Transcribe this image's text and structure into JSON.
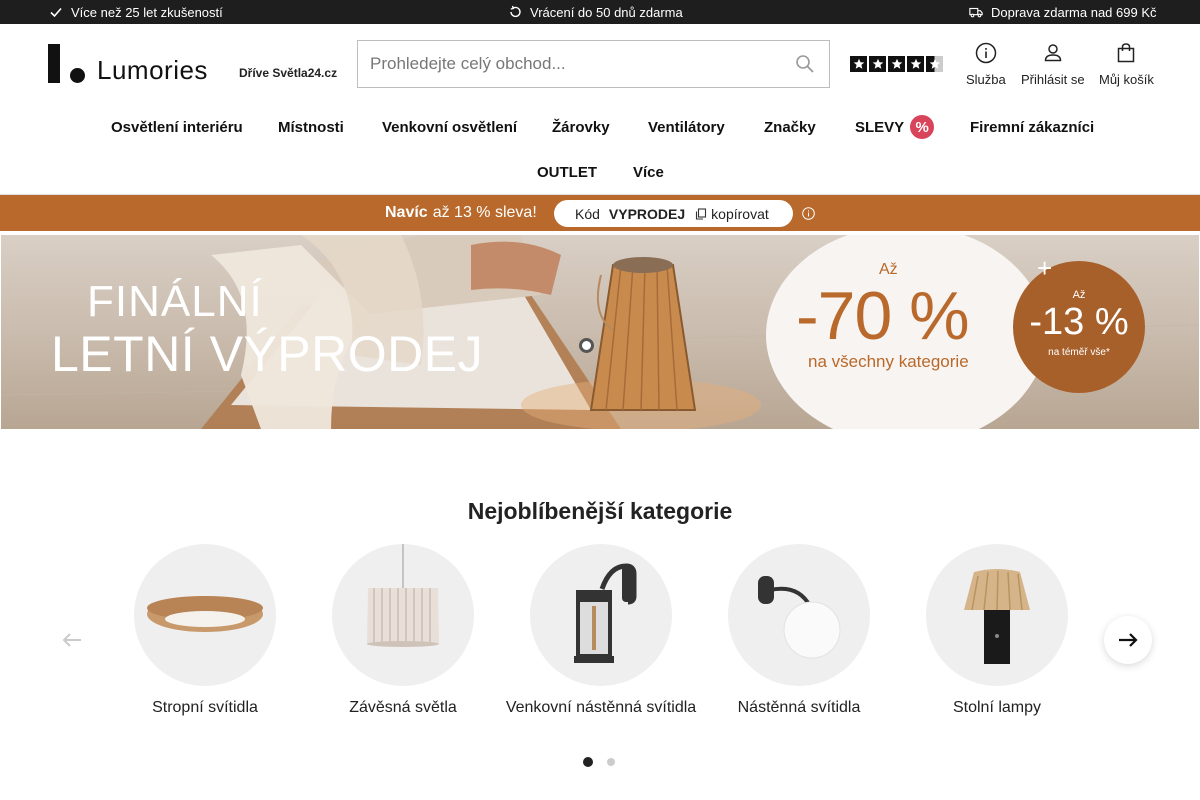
{
  "topbar": {
    "experience": "Více než 25 let zkušeností",
    "returns": "Vrácení do 50 dnů zdarma",
    "shipping": "Doprava zdarma nad 699 Kč"
  },
  "header": {
    "logo_text": "Lumories",
    "formerly": "Dříve Světla24.cz",
    "search_placeholder": "Prohledejte celý obchod...",
    "rating_stars": 4.5,
    "service_label": "Služba",
    "login_label": "Přihlásit se",
    "cart_label": "Můj košík"
  },
  "nav": {
    "items": [
      "Osvětlení interiéru",
      "Místnosti",
      "Venkovní osvětlení",
      "Žárovky",
      "Ventilátory",
      "Značky",
      "SLEVY",
      "Firemní zákazníci",
      "OUTLET",
      "Více"
    ],
    "sale_badge": "%"
  },
  "promo": {
    "bold": "Navíc",
    "text": "až 13 % sleva!",
    "code_label": "Kód",
    "code": "VYPRODEJ",
    "copy_label": "kopírovat",
    "accent_color": "#b8692b"
  },
  "banner": {
    "title_line1": "FINÁLNÍ",
    "title_line2": "LETNÍ VÝPRODEJ",
    "discount_prefix": "Až",
    "discount": "-70 %",
    "discount_sub": "na všechny kategorie",
    "extra_plus": "+",
    "extra_prefix": "Až",
    "extra_discount": "-13 %",
    "extra_sub": "na téměř vše*"
  },
  "categories": {
    "title": "Nejoblíbenější kategorie",
    "items": [
      "Stropní svítidla",
      "Závěsná světla",
      "Venkovní nástěnná svítidla",
      "Nástěnná svítidla",
      "Stolní lampy"
    ],
    "page_count": 2,
    "active_page": 1
  }
}
